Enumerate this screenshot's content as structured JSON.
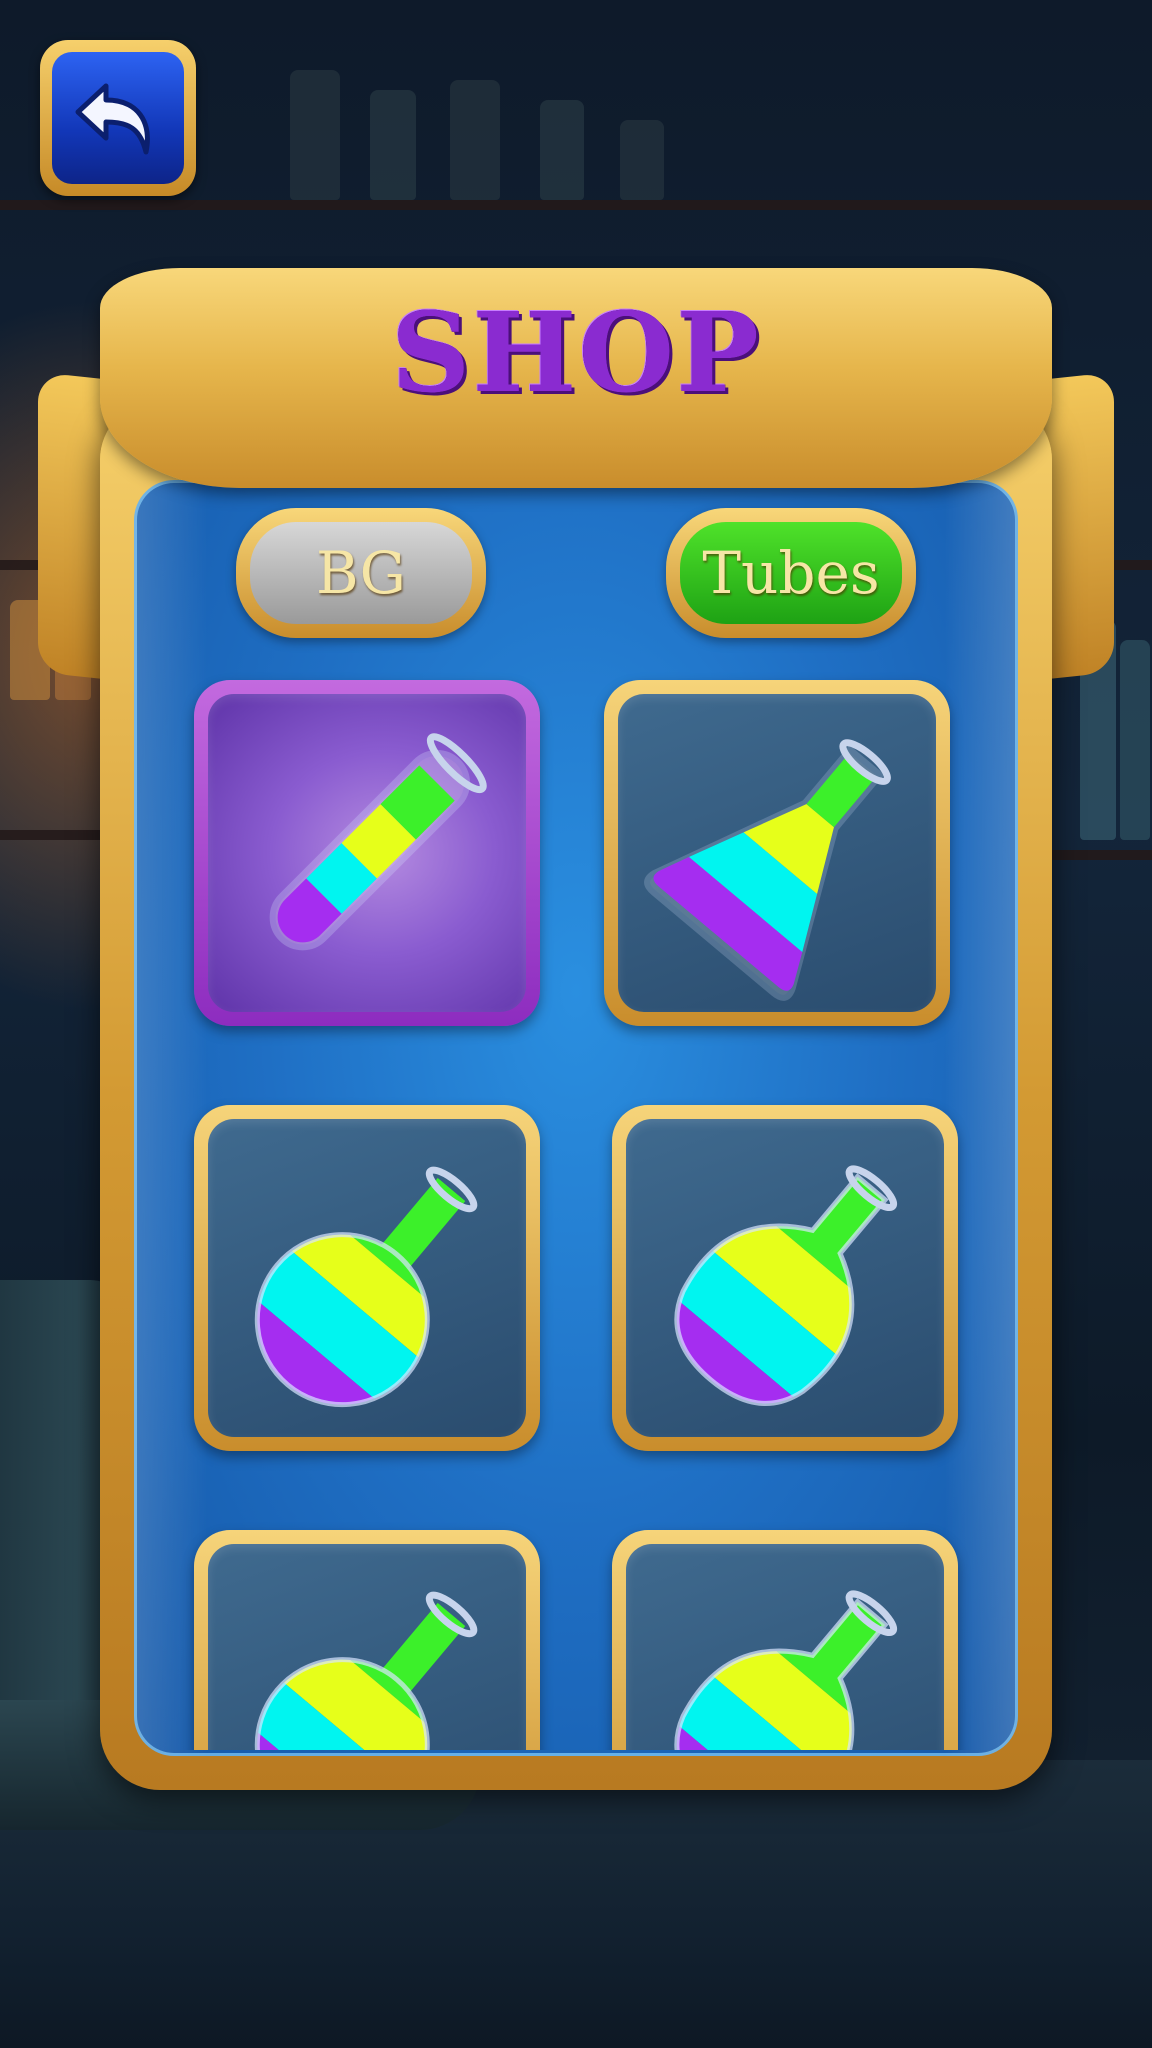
{
  "screen": {
    "title": "SHOP"
  },
  "tabs": [
    {
      "label": "BG",
      "active": false
    },
    {
      "label": "Tubes",
      "active": true
    }
  ],
  "items": [
    {
      "icon": "test-tube-icon",
      "selected": true
    },
    {
      "icon": "conical-flask-icon",
      "selected": false
    },
    {
      "icon": "round-flask-icon",
      "selected": false
    },
    {
      "icon": "pear-flask-icon",
      "selected": false
    },
    {
      "icon": "round-flask-icon",
      "selected": false
    },
    {
      "icon": "pear-flask-icon",
      "selected": false
    }
  ],
  "colors": {
    "title": "#8a2bd0",
    "gold": "#e6b64c",
    "panel_blue": "#1f6fc4",
    "tab_active": "#1ea214",
    "tab_inactive": "#9a9a9a",
    "selected_card": "#8d2cbf",
    "liquid": [
      "#a52df0",
      "#00f5f0",
      "#e6ff1a",
      "#3cf02a"
    ]
  }
}
